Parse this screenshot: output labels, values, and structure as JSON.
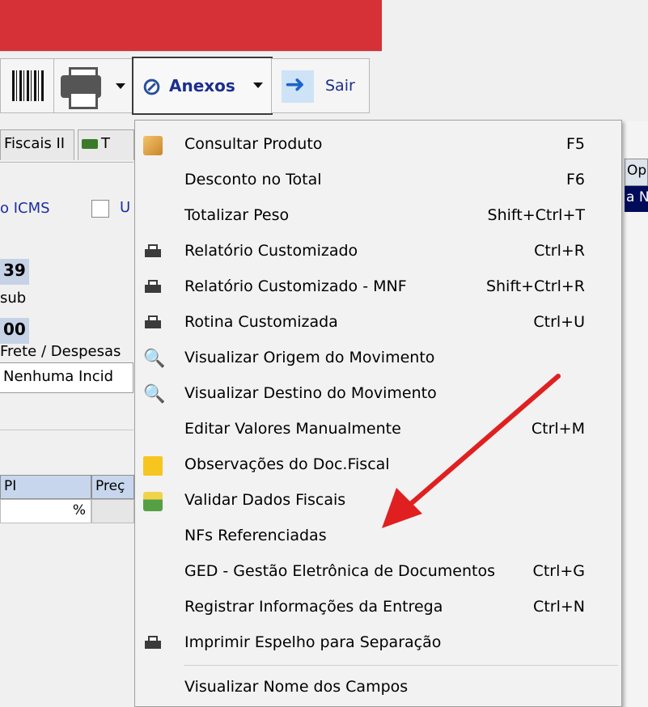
{
  "toolbar": {
    "anexos_label": "Anexos",
    "sair_label": "Sair"
  },
  "form": {
    "tab_fiscais": "Fiscais II",
    "tab_t": "T",
    "icms_label": "o ICMS",
    "u_label": "U",
    "num1": "39",
    "sub_label": "sub",
    "num2": "00",
    "frete_label": "Frete / Despesas",
    "combo_value": "Nenhuma Incid",
    "grid_col1": "PI",
    "grid_col2": "Preç",
    "grid_percent": "%"
  },
  "right_pane": {
    "header": "Op",
    "selected": "a N"
  },
  "menu": {
    "items": [
      {
        "label": "Consultar Produto",
        "shortcut": "F5",
        "icon": "package-icon"
      },
      {
        "label": "Desconto no Total",
        "shortcut": "F6",
        "icon": ""
      },
      {
        "label": "Totalizar Peso",
        "shortcut": "Shift+Ctrl+T",
        "icon": ""
      },
      {
        "label": "Relatório Customizado",
        "shortcut": "Ctrl+R",
        "icon": "printer-icon"
      },
      {
        "label": "Relatório Customizado - MNF",
        "shortcut": "Shift+Ctrl+R",
        "icon": "printer-icon"
      },
      {
        "label": "Rotina Customizada",
        "shortcut": "Ctrl+U",
        "icon": "printer-icon"
      },
      {
        "label": "Visualizar Origem do Movimento",
        "shortcut": "",
        "icon": "magnifier-icon"
      },
      {
        "label": "Visualizar Destino do Movimento",
        "shortcut": "",
        "icon": "magnifier-icon"
      },
      {
        "label": "Editar Valores Manualmente",
        "shortcut": "Ctrl+M",
        "icon": ""
      },
      {
        "label": "Observações do Doc.Fiscal",
        "shortcut": "",
        "icon": "sticky-note-icon"
      },
      {
        "label": "Validar Dados Fiscais",
        "shortcut": "",
        "icon": "validate-icon"
      },
      {
        "label": "NFs Referenciadas",
        "shortcut": "",
        "icon": ""
      },
      {
        "label": "GED - Gestão Eletrônica de Documentos",
        "shortcut": "Ctrl+G",
        "icon": ""
      },
      {
        "label": "Registrar Informações da Entrega",
        "shortcut": "Ctrl+N",
        "icon": ""
      },
      {
        "label": "Imprimir Espelho para Separação",
        "shortcut": "",
        "icon": "printer-icon"
      },
      {
        "label": "Visualizar Nome dos Campos",
        "shortcut": "",
        "icon": ""
      }
    ]
  },
  "colors": {
    "titlebar": "#d53136",
    "grid_header": "#c7d6ec",
    "selection": "#000c5a",
    "annotation_arrow": "#e02020"
  }
}
